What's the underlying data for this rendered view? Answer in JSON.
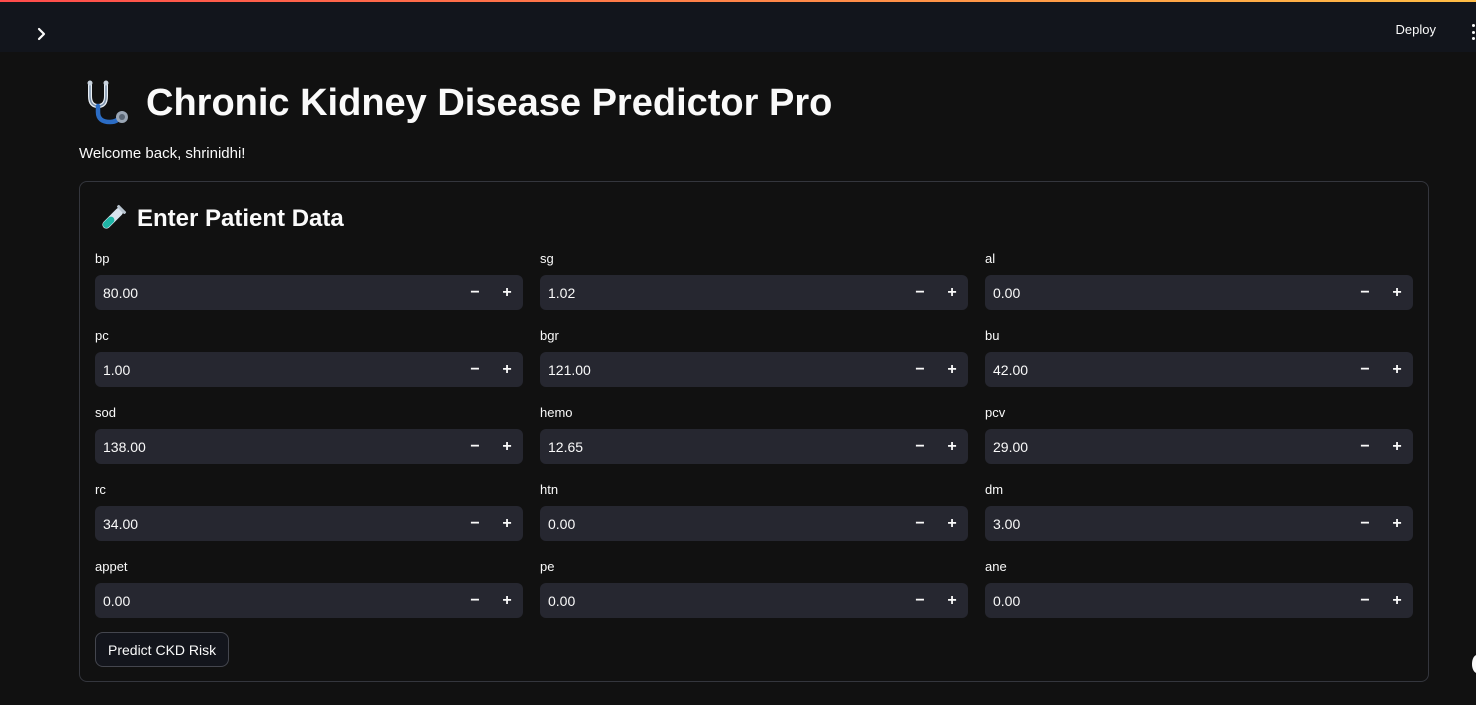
{
  "header": {
    "deploy_label": "Deploy"
  },
  "main": {
    "title": "Chronic Kidney Disease Predictor Pro",
    "welcome": "Welcome back, shrinidhi!",
    "form": {
      "title": "Enter Patient Data",
      "fields": [
        {
          "label": "bp",
          "value": "80.00"
        },
        {
          "label": "sg",
          "value": "1.02"
        },
        {
          "label": "al",
          "value": "0.00"
        },
        {
          "label": "pc",
          "value": "1.00"
        },
        {
          "label": "bgr",
          "value": "121.00"
        },
        {
          "label": "bu",
          "value": "42.00"
        },
        {
          "label": "sod",
          "value": "138.00"
        },
        {
          "label": "hemo",
          "value": "12.65"
        },
        {
          "label": "pcv",
          "value": "29.00"
        },
        {
          "label": "rc",
          "value": "34.00"
        },
        {
          "label": "htn",
          "value": "0.00"
        },
        {
          "label": "dm",
          "value": "3.00"
        },
        {
          "label": "appet",
          "value": "0.00"
        },
        {
          "label": "pe",
          "value": "0.00"
        },
        {
          "label": "ane",
          "value": "0.00"
        }
      ],
      "stepper_minus": "−",
      "stepper_plus": "+",
      "submit_label": "Predict CKD Risk"
    }
  },
  "icons": {
    "sidebar_toggle": "chevron-right-icon",
    "title": "stethoscope-icon",
    "form": "test-tube-icon",
    "menu": "more-vertical-icon"
  },
  "colors": {
    "background": "#111111",
    "input_bg": "#262730",
    "border": "#34363d",
    "text": "#fafafa"
  }
}
